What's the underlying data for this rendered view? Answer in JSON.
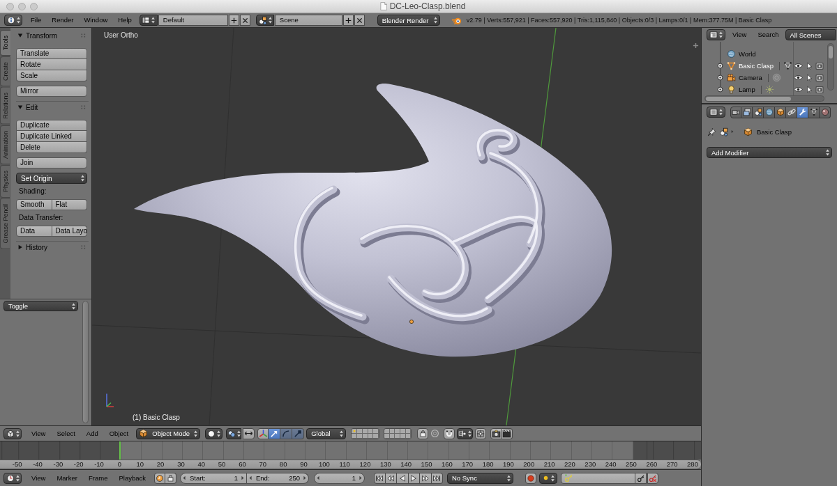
{
  "window": {
    "title": "DC-Leo-Clasp.blend"
  },
  "info_header": {
    "menus": [
      "File",
      "Render",
      "Window",
      "Help"
    ],
    "screen_layout": "Default",
    "scene": "Scene",
    "render_engine": "Blender Render",
    "stats": "v2.79 | Verts:557,921 | Faces:557,920 | Tris:1,115,840 | Objects:0/3 | Lamps:0/1 | Mem:377.75M | Basic Clasp"
  },
  "tool_shelf": {
    "tabs": [
      {
        "label": "Tools",
        "selected": true
      },
      {
        "label": "Create",
        "selected": false
      },
      {
        "label": "Relations",
        "selected": false
      },
      {
        "label": "Animation",
        "selected": false
      },
      {
        "label": "Physics",
        "selected": false
      },
      {
        "label": "Grease Pencil",
        "selected": false
      }
    ],
    "panels": [
      {
        "title": "Transform",
        "expanded": true,
        "rows": [
          {
            "kind": "stack",
            "buttons": [
              "Translate",
              "Rotate",
              "Scale"
            ]
          },
          {
            "kind": "stack",
            "buttons": [
              "Mirror"
            ]
          }
        ]
      },
      {
        "title": "Edit",
        "expanded": true,
        "rows": [
          {
            "kind": "stack",
            "buttons": [
              "Duplicate",
              "Duplicate Linked",
              "Delete"
            ]
          },
          {
            "kind": "stack",
            "buttons": [
              "Join"
            ]
          },
          {
            "kind": "menu",
            "label": "Set Origin"
          },
          {
            "kind": "label",
            "label": "Shading:"
          },
          {
            "kind": "row",
            "buttons": [
              "Smooth",
              "Flat"
            ]
          },
          {
            "kind": "label",
            "label": "Data Transfer:"
          },
          {
            "kind": "row",
            "buttons": [
              "Data",
              "Data Layo"
            ]
          }
        ]
      },
      {
        "title": "History",
        "expanded": false
      }
    ],
    "operator_menu": "Toggle"
  },
  "viewport": {
    "view_name": "User Ortho",
    "object_label": "(1) Basic Clasp"
  },
  "view3d_header": {
    "menus": [
      "View",
      "Select",
      "Add",
      "Object"
    ],
    "mode": "Object Mode",
    "manipulators": [
      {
        "kind": "translate",
        "selected": true
      },
      {
        "kind": "rotate",
        "selected": false
      },
      {
        "kind": "scale",
        "selected": false
      }
    ],
    "orientation": "Global"
  },
  "timeline": {
    "ruler": [
      "-50",
      "-40",
      "-30",
      "-20",
      "-10",
      "0",
      "10",
      "20",
      "30",
      "40",
      "50",
      "60",
      "70",
      "80",
      "90",
      "100",
      "110",
      "120",
      "130",
      "140",
      "150",
      "160",
      "170",
      "180",
      "190",
      "200",
      "210",
      "220",
      "230",
      "240",
      "250",
      "260",
      "270",
      "280"
    ],
    "menus": [
      "View",
      "Marker",
      "Frame",
      "Playback"
    ],
    "start_label": "Start:",
    "start": "1",
    "end_label": "End:",
    "end": "250",
    "current_frame": "1",
    "sync": "No Sync"
  },
  "outliner": {
    "menus": [
      "View",
      "Search"
    ],
    "display_mode": "All Scenes",
    "rows": [
      {
        "kind": "world",
        "name": "World",
        "selected": false
      },
      {
        "kind": "mesh",
        "name": "Basic Clasp",
        "selected": true
      },
      {
        "kind": "camera",
        "name": "Camera",
        "selected": false
      },
      {
        "kind": "lamp",
        "name": "Lamp",
        "selected": false
      }
    ]
  },
  "properties": {
    "tabs": [
      {
        "kind": "render",
        "selected": false
      },
      {
        "kind": "render_layers",
        "selected": false
      },
      {
        "kind": "scene",
        "selected": false
      },
      {
        "kind": "world",
        "selected": false
      },
      {
        "kind": "object",
        "selected": false
      },
      {
        "kind": "constraints",
        "selected": false
      },
      {
        "kind": "modifiers",
        "selected": true
      },
      {
        "kind": "data",
        "selected": false
      },
      {
        "kind": "material",
        "selected": false
      }
    ],
    "object_name": "Basic Clasp",
    "add_modifier": "Add Modifier"
  }
}
